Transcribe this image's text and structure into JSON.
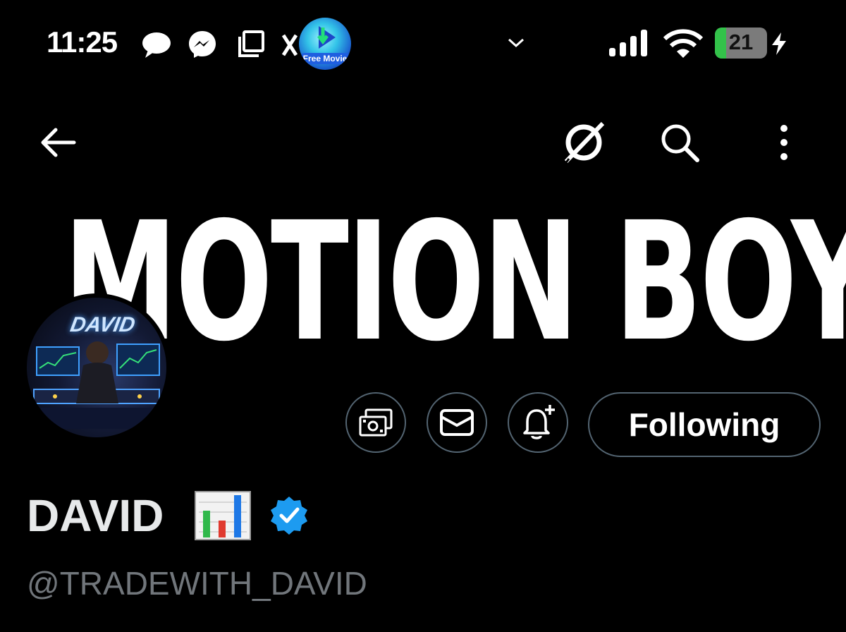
{
  "status_bar": {
    "time": "11:25",
    "free_movie_label": "Free Movie",
    "battery_level": "21",
    "battery_fraction": 0.21,
    "icons": [
      "chat-bubble-icon",
      "messenger-icon",
      "copy-icon",
      "x-icon",
      "free-movie-app-icon",
      "chevron-down-icon",
      "signal-icon",
      "wifi-icon",
      "battery-icon",
      "charging-bolt-icon"
    ]
  },
  "banner": {
    "title": "MOTION BOY"
  },
  "top_nav": {
    "icons": [
      "back-arrow-icon",
      "grok-icon",
      "search-icon",
      "more-vertical-icon"
    ]
  },
  "avatar": {
    "name_text": "DAVID"
  },
  "actions": {
    "icons": [
      "tip-jar-icon",
      "message-icon",
      "notification-bell-plus-icon"
    ],
    "following_label": "Following"
  },
  "profile": {
    "display_name": "DAVID",
    "emoji": "bar-chart-emoji",
    "verified": "verified-badge-icon",
    "handle": "@TRADEWITH_DAVID"
  },
  "colors": {
    "background": "#000000",
    "text": "#e7e9ea",
    "muted": "#71767b",
    "border": "#536471",
    "verified": "#1d9bf0"
  }
}
